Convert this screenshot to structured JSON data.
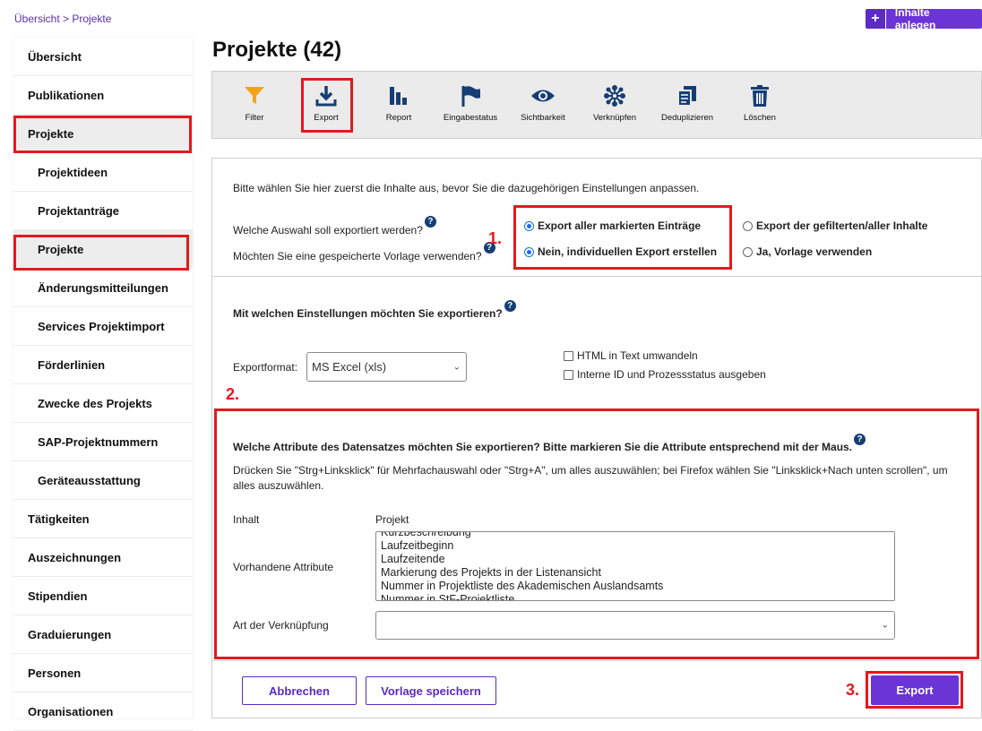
{
  "breadcrumb": {
    "home": "Übersicht",
    "separator": " > ",
    "current": "Projekte"
  },
  "header": {
    "add_button_icon": "plus-icon",
    "add_button_label": "Inhalte anlegen"
  },
  "sidebar": {
    "items": [
      {
        "label": "Übersicht"
      },
      {
        "label": "Publikationen"
      },
      {
        "label": "Projekte"
      },
      {
        "label": "Projektideen"
      },
      {
        "label": "Projektanträge"
      },
      {
        "label": "Projekte"
      },
      {
        "label": "Änderungsmitteilungen"
      },
      {
        "label": "Services Projektimport"
      },
      {
        "label": "Förderlinien"
      },
      {
        "label": "Zwecke des Projekts"
      },
      {
        "label": "SAP-Projektnummern"
      },
      {
        "label": "Geräteausstattung"
      },
      {
        "label": "Tätigkeiten"
      },
      {
        "label": "Auszeichnungen"
      },
      {
        "label": "Stipendien"
      },
      {
        "label": "Graduierungen"
      },
      {
        "label": "Personen"
      },
      {
        "label": "Organisationen"
      }
    ]
  },
  "main": {
    "title": "Projekte (42)"
  },
  "toolbar": {
    "items": [
      {
        "label": "Filter",
        "icon": "filter-icon"
      },
      {
        "label": "Export",
        "icon": "download-icon"
      },
      {
        "label": "Report",
        "icon": "bar-chart-icon"
      },
      {
        "label": "Eingabestatus",
        "icon": "flag-icon"
      },
      {
        "label": "Sichtbarkeit",
        "icon": "eye-icon"
      },
      {
        "label": "Verknüpfen",
        "icon": "network-icon"
      },
      {
        "label": "Deduplizieren",
        "icon": "copy-icon"
      },
      {
        "label": "Löschen",
        "icon": "trash-icon"
      }
    ]
  },
  "export": {
    "intro": "Bitte wählen Sie hier zuerst die Inhalte aus, bevor Sie die dazugehörigen Einstellungen anpassen.",
    "q_selection": "Welche Auswahl soll exportiert werden?",
    "q_template": "Möchten Sie eine gespeicherte Vorlage verwenden?",
    "opt_all_marked": "Export aller markierten Einträge",
    "opt_filtered": "Export der gefilterten/aller Inhalte",
    "opt_individual": "Nein, individuellen Export erstellen",
    "opt_template": "Ja, Vorlage verwenden",
    "settings_heading": "Mit welchen Einstellungen möchten Sie exportieren?",
    "format_label": "Exportformat:",
    "format_value": "MS Excel (xls)",
    "chk_html": "HTML in Text umwandeln",
    "chk_internal": "Interne ID und Prozessstatus ausgeben",
    "attr_heading": "Welche Attribute des Datensatzes möchten Sie exportieren? Bitte markieren Sie die Attribute entsprechend mit der Maus.",
    "attr_hint": "Drücken Sie \"Strg+Linksklick\" für Mehrfachauswahl oder \"Strg+A\", um alles auszuwählen; bei Firefox wählen Sie \"Linksklick+Nach unten scrollen\", um alles auszuwählen.",
    "content_label": "Inhalt",
    "content_value": "Projekt",
    "attrs_label": "Vorhandene Attribute",
    "attributes": [
      "Kurzbeschreibung",
      "Laufzeitbeginn",
      "Laufzeitende",
      "Markierung des Projekts in der Listenansicht",
      "Nummer in Projektliste des Akademischen Auslandsamts",
      "Nummer in StF-Projektliste"
    ],
    "link_label": "Art der Verknüpfung",
    "link_value": "",
    "cancel_label": "Abbrechen",
    "save_template_label": "Vorlage speichern",
    "export_label": "Export"
  },
  "annotations": {
    "step1": "1.",
    "step2": "2.",
    "step3": "3."
  },
  "colors": {
    "accent": "#6b34d6",
    "annotation_red": "#e3191e",
    "icon_blue": "#153e75",
    "filter_orange": "#f5a21b"
  }
}
